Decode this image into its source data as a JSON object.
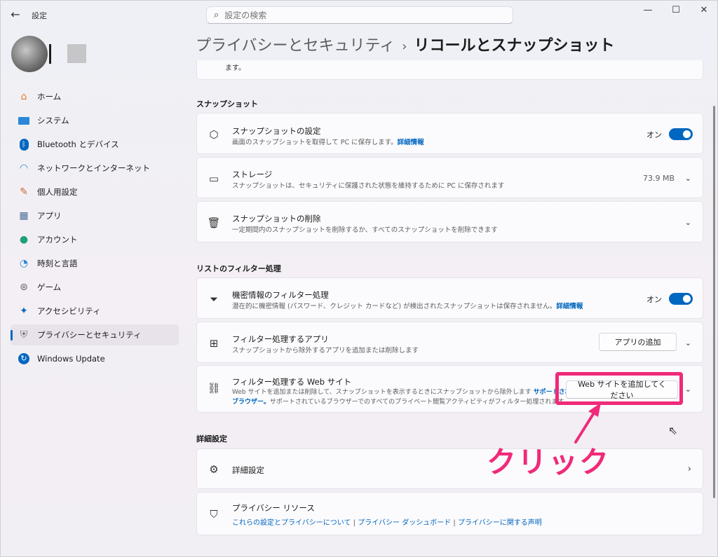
{
  "window": {
    "app_title": "設定",
    "search_placeholder": "設定の検索"
  },
  "sidebar": {
    "items": [
      {
        "label": "ホーム",
        "icon": "home-icon"
      },
      {
        "label": "システム",
        "icon": "system-icon"
      },
      {
        "label": "Bluetooth とデバイス",
        "icon": "bluetooth-icon"
      },
      {
        "label": "ネットワークとインターネット",
        "icon": "wifi-icon"
      },
      {
        "label": "個人用設定",
        "icon": "brush-icon"
      },
      {
        "label": "アプリ",
        "icon": "apps-icon"
      },
      {
        "label": "アカウント",
        "icon": "account-icon"
      },
      {
        "label": "時刻と言語",
        "icon": "clock-globe-icon"
      },
      {
        "label": "ゲーム",
        "icon": "gamepad-icon"
      },
      {
        "label": "アクセシビリティ",
        "icon": "accessibility-icon"
      },
      {
        "label": "プライバシーとセキュリティ",
        "icon": "shield-icon",
        "active": true
      },
      {
        "label": "Windows Update",
        "icon": "update-icon"
      }
    ]
  },
  "breadcrumb": {
    "parent": "プライバシーとセキュリティ",
    "separator": "›",
    "current": "リコールとスナップショット"
  },
  "top_cut_text": "ます。",
  "sections": {
    "snapshots": "スナップショット",
    "filter": "リストのフィルター処理",
    "advanced": "詳細設定"
  },
  "cards": {
    "snapshot_settings": {
      "title": "スナップショットの設定",
      "desc": "画面のスナップショットを取得して PC に保存します。",
      "link": "詳細情報",
      "toggle_label": "オン"
    },
    "storage": {
      "title": "ストレージ",
      "desc": "スナップショットは、セキュリティに保護された状態を維持するために PC に保存されます",
      "value": "73.9 MB"
    },
    "delete_snapshots": {
      "title": "スナップショットの削除",
      "desc": "一定期間内のスナップショットを削除するか、すべてのスナップショットを削除できます"
    },
    "sensitive_filter": {
      "title": "機密情報のフィルター処理",
      "desc": "潜在的に機密情報 (パスワード、クレジット カードなど) が検出されたスナップショットは保存されません。",
      "link": "詳細情報",
      "toggle_label": "オン"
    },
    "filter_apps": {
      "title": "フィルター処理するアプリ",
      "desc": "スナップショットから除外するアプリを追加または削除します",
      "button": "アプリの追加"
    },
    "filter_websites": {
      "title": "フィルター処理する Web サイト",
      "desc_line1": "Web サイトを追加または削除して、スナップショットを表示するときにスナップショットから除外します",
      "link_line1": "サポートされている",
      "link_line2": "ブラウザー。",
      "desc_line2": "サポートされているブラウザーでのすべてのプライベート閲覧アクティビティがフィルター処理されます。",
      "button": "Web サイトを追加してください"
    },
    "advanced_settings": {
      "title": "詳細設定"
    },
    "privacy_resources": {
      "title": "プライバシー リソース",
      "link1": "これらの設定とプライバシーについて",
      "link2": "プライバシー ダッシュボード",
      "link3": "プライバシーに関する声明"
    }
  },
  "annotation": {
    "label": "クリック",
    "color": "#f02a79"
  },
  "colors": {
    "accent": "#0067c0",
    "highlight": "#f02a79"
  }
}
